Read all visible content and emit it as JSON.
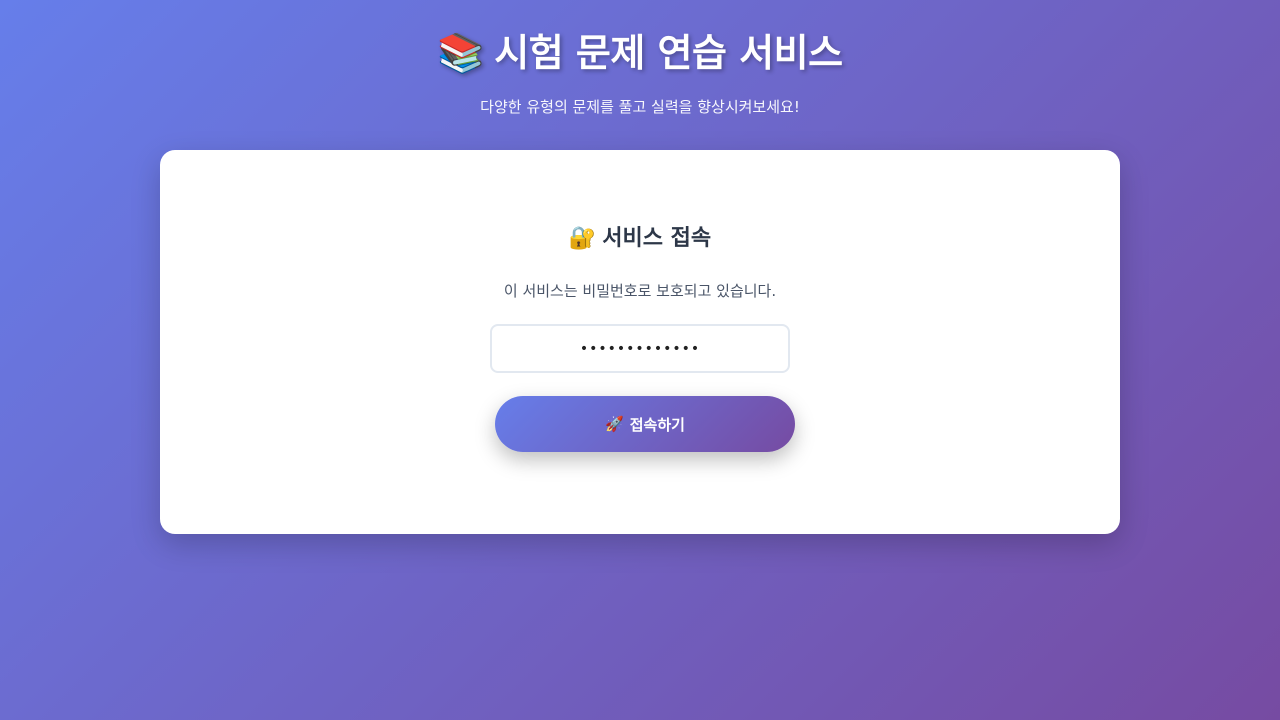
{
  "header": {
    "icon": "books-icon",
    "icon_glyph": "📚",
    "title": "시험 문제 연습 서비스",
    "subtitle": "다양한 유형의 문제를 풀고 실력을 향상시켜보세요!"
  },
  "login": {
    "icon": "lock-with-key-icon",
    "icon_glyph": "🔐",
    "title": "서비스 접속",
    "description": "이 서비스는 비밀번호로 보호되고 있습니다.",
    "password_value": "•••••••••••••",
    "button_icon": "rocket-icon",
    "button_icon_glyph": "🚀",
    "button_label": "접속하기"
  },
  "colors": {
    "gradient_start": "#667eea",
    "gradient_end": "#764ba2",
    "card_background": "#ffffff"
  }
}
